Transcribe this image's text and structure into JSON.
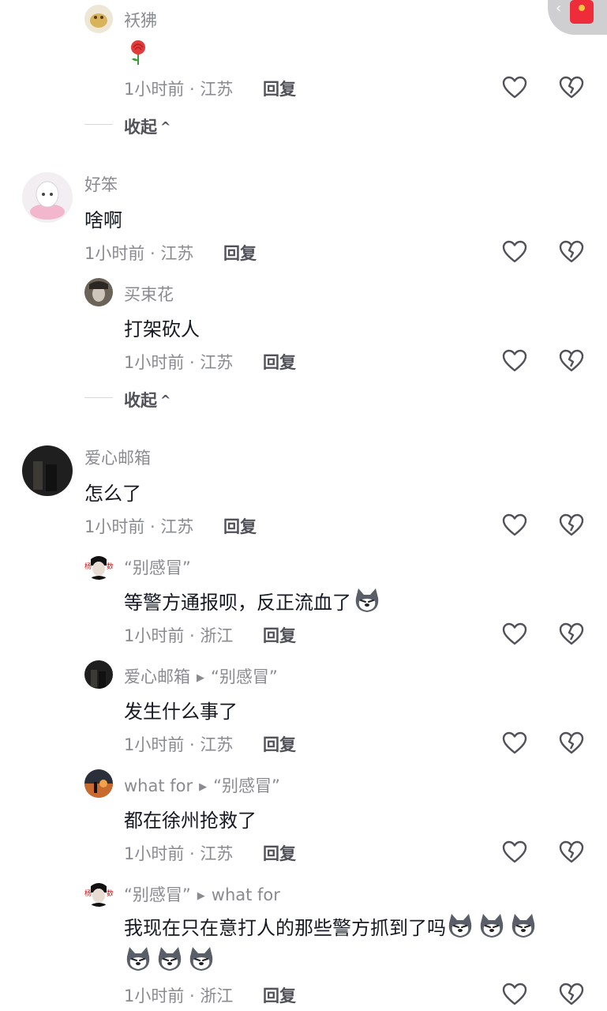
{
  "top_reply": {
    "name": "袄狒",
    "emoji": "rose-emoji",
    "time_location": "1小时前 · 江苏",
    "reply_label": "回复"
  },
  "collapse_label": "收起",
  "comments": [
    {
      "name": "好笨",
      "text": "啥啊",
      "time_location": "1小时前 · 江苏",
      "reply_label": "回复",
      "replies": [
        {
          "name": "买束花",
          "text": "打架砍人",
          "time_location": "1小时前 · 江苏",
          "reply_label": "回复"
        }
      ]
    },
    {
      "name": "爱心邮箱",
      "text": "怎么了",
      "time_location": "1小时前 · 江苏",
      "reply_label": "回复",
      "replies": [
        {
          "name": "“别感冒”",
          "text": "等警方通报呗，反正流血了",
          "emoji_count": 1,
          "time_location": "1小时前 · 浙江",
          "reply_label": "回复"
        },
        {
          "name": "爱心邮箱",
          "reply_to": "“别感冒”",
          "text": "发生什么事了",
          "time_location": "1小时前 · 江苏",
          "reply_label": "回复"
        },
        {
          "name": "what for",
          "reply_to": "“别感冒”",
          "text": "都在徐州抢救了",
          "time_location": "1小时前 · 江苏",
          "reply_label": "回复"
        },
        {
          "name": "“别感冒”",
          "reply_to": "what for",
          "text": "我现在只在意打人的那些警方抓到了吗",
          "emoji_line1": 3,
          "emoji_line2": 3,
          "time_location": "1小时前 · 浙江",
          "reply_label": "回复"
        }
      ]
    }
  ],
  "icons": {
    "like": "heart-outline-icon",
    "dislike": "broken-heart-icon",
    "emoji_sticker": "husky-dog-emoji",
    "red_packet": "red-packet-icon"
  },
  "colors": {
    "text": "#161823",
    "secondary": "#8a8b91",
    "reply": "#505159",
    "red_packet": "#ee2c3a"
  }
}
